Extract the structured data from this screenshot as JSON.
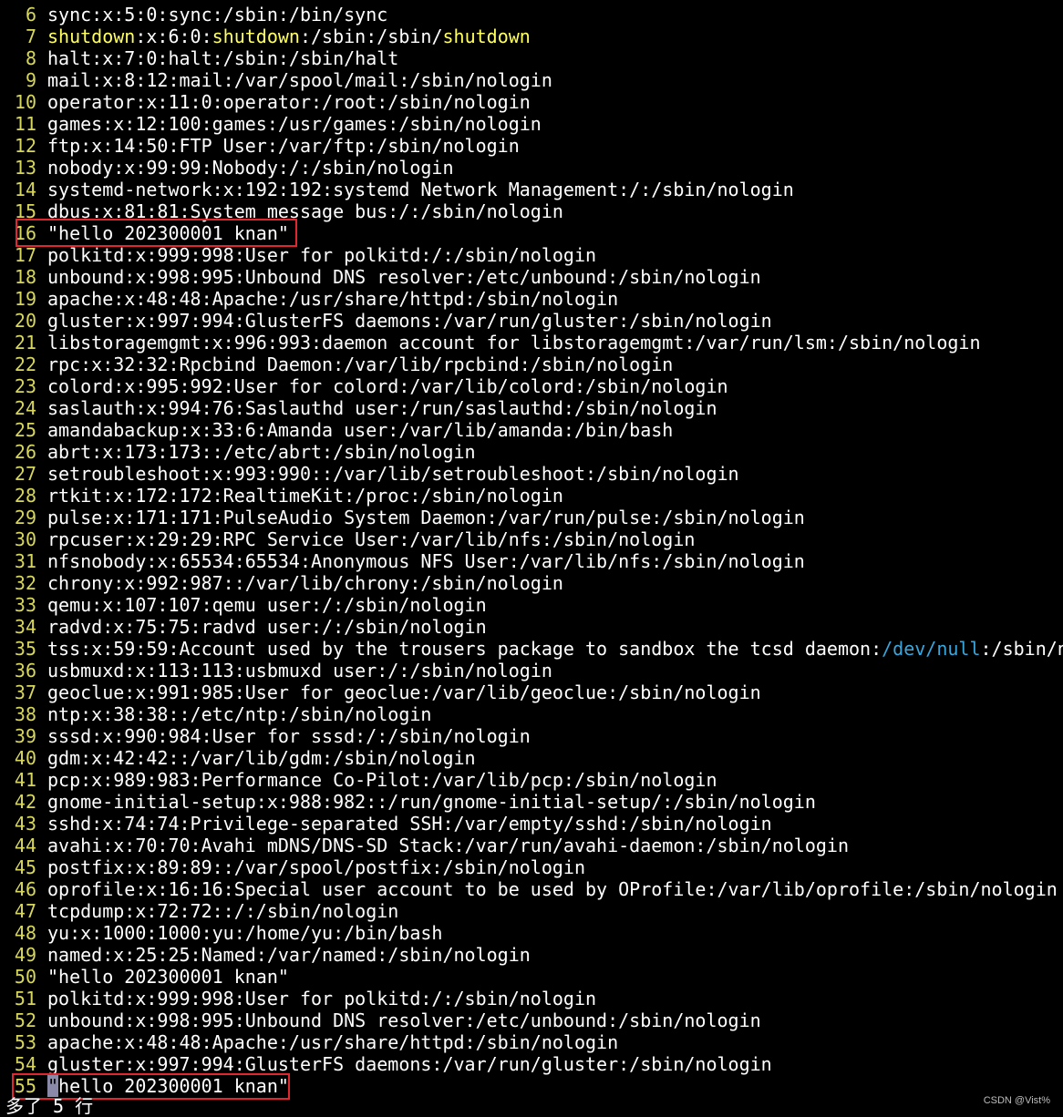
{
  "lines": [
    {
      "n": "6",
      "segments": [
        {
          "t": "sync:x:5:0:sync:/sbin:/bin/sync"
        }
      ]
    },
    {
      "n": "7",
      "segments": [
        {
          "t": "shutdown",
          "c": "kw"
        },
        {
          "t": ":x:6:0:"
        },
        {
          "t": "shutdown",
          "c": "kw"
        },
        {
          "t": ":/sbin:/sbin/"
        },
        {
          "t": "shutdown",
          "c": "kw"
        }
      ]
    },
    {
      "n": "8",
      "segments": [
        {
          "t": "halt:x:7:0:halt:/sbin:/sbin/halt"
        }
      ]
    },
    {
      "n": "9",
      "segments": [
        {
          "t": "mail:x:8:12:mail:/var/spool/mail:/sbin/nologin"
        }
      ]
    },
    {
      "n": "10",
      "segments": [
        {
          "t": "operator:x:11:0:operator:/root:/sbin/nologin"
        }
      ]
    },
    {
      "n": "11",
      "segments": [
        {
          "t": "games:x:12:100:games:/usr/games:/sbin/nologin"
        }
      ]
    },
    {
      "n": "12",
      "segments": [
        {
          "t": "ftp:x:14:50:FTP User:/var/ftp:/sbin/nologin"
        }
      ]
    },
    {
      "n": "13",
      "segments": [
        {
          "t": "nobody:x:99:99:Nobody:/:/sbin/nologin"
        }
      ]
    },
    {
      "n": "14",
      "segments": [
        {
          "t": "systemd-network:x:192:192:systemd Network Management:/:/sbin/nologin"
        }
      ]
    },
    {
      "n": "15",
      "segments": [
        {
          "t": "dbus:x:81:81:System message bus:/:/sbin/nologin"
        }
      ]
    },
    {
      "n": "16",
      "segments": [
        {
          "t": "\"hello 202300001 knan\""
        }
      ]
    },
    {
      "n": "17",
      "segments": [
        {
          "t": "polkitd:x:999:998:User for polkitd:/:/sbin/nologin"
        }
      ]
    },
    {
      "n": "18",
      "segments": [
        {
          "t": "unbound:x:998:995:Unbound DNS resolver:/etc/unbound:/sbin/nologin"
        }
      ]
    },
    {
      "n": "19",
      "segments": [
        {
          "t": "apache:x:48:48:Apache:/usr/share/httpd:/sbin/nologin"
        }
      ]
    },
    {
      "n": "20",
      "segments": [
        {
          "t": "gluster:x:997:994:GlusterFS daemons:/var/run/gluster:/sbin/nologin"
        }
      ]
    },
    {
      "n": "21",
      "segments": [
        {
          "t": "libstoragemgmt:x:996:993:daemon account for libstoragemgmt:/var/run/lsm:/sbin/nologin"
        }
      ]
    },
    {
      "n": "22",
      "segments": [
        {
          "t": "rpc:x:32:32:Rpcbind Daemon:/var/lib/rpcbind:/sbin/nologin"
        }
      ]
    },
    {
      "n": "23",
      "segments": [
        {
          "t": "colord:x:995:992:User for colord:/var/lib/colord:/sbin/nologin"
        }
      ]
    },
    {
      "n": "24",
      "segments": [
        {
          "t": "saslauth:x:994:76:Saslauthd user:/run/saslauthd:/sbin/nologin"
        }
      ]
    },
    {
      "n": "25",
      "segments": [
        {
          "t": "amandabackup:x:33:6:Amanda user:/var/lib/amanda:/bin/bash"
        }
      ]
    },
    {
      "n": "26",
      "segments": [
        {
          "t": "abrt:x:173:173::/etc/abrt:/sbin/nologin"
        }
      ]
    },
    {
      "n": "27",
      "segments": [
        {
          "t": "setroubleshoot:x:993:990::/var/lib/setroubleshoot:/sbin/nologin"
        }
      ]
    },
    {
      "n": "28",
      "segments": [
        {
          "t": "rtkit:x:172:172:RealtimeKit:/proc:/sbin/nologin"
        }
      ]
    },
    {
      "n": "29",
      "segments": [
        {
          "t": "pulse:x:171:171:PulseAudio System Daemon:/var/run/pulse:/sbin/nologin"
        }
      ]
    },
    {
      "n": "30",
      "segments": [
        {
          "t": "rpcuser:x:29:29:RPC Service User:/var/lib/nfs:/sbin/nologin"
        }
      ]
    },
    {
      "n": "31",
      "segments": [
        {
          "t": "nfsnobody:x:65534:65534:Anonymous NFS User:/var/lib/nfs:/sbin/nologin"
        }
      ]
    },
    {
      "n": "32",
      "segments": [
        {
          "t": "chrony:x:992:987::/var/lib/chrony:/sbin/nologin"
        }
      ]
    },
    {
      "n": "33",
      "segments": [
        {
          "t": "qemu:x:107:107:qemu user:/:/sbin/nologin"
        }
      ]
    },
    {
      "n": "34",
      "segments": [
        {
          "t": "radvd:x:75:75:radvd user:/:/sbin/nologin"
        }
      ]
    },
    {
      "n": "35",
      "segments": [
        {
          "t": "tss:x:59:59:Account used by the trousers package to sandbox the tcsd daemon:"
        },
        {
          "t": "/dev/null",
          "c": "path"
        },
        {
          "t": ":/sbin/n"
        }
      ]
    },
    {
      "n": "36",
      "segments": [
        {
          "t": "usbmuxd:x:113:113:usbmuxd user:/:/sbin/nologin"
        }
      ]
    },
    {
      "n": "37",
      "segments": [
        {
          "t": "geoclue:x:991:985:User for geoclue:/var/lib/geoclue:/sbin/nologin"
        }
      ]
    },
    {
      "n": "38",
      "segments": [
        {
          "t": "ntp:x:38:38::/etc/ntp:/sbin/nologin"
        }
      ]
    },
    {
      "n": "39",
      "segments": [
        {
          "t": "sssd:x:990:984:User for sssd:/:/sbin/nologin"
        }
      ]
    },
    {
      "n": "40",
      "segments": [
        {
          "t": "gdm:x:42:42::/var/lib/gdm:/sbin/nologin"
        }
      ]
    },
    {
      "n": "41",
      "segments": [
        {
          "t": "pcp:x:989:983:Performance Co-Pilot:/var/lib/pcp:/sbin/nologin"
        }
      ]
    },
    {
      "n": "42",
      "segments": [
        {
          "t": "gnome-initial-setup:x:988:982::/run/gnome-initial-setup/:/sbin/nologin"
        }
      ]
    },
    {
      "n": "43",
      "segments": [
        {
          "t": "sshd:x:74:74:Privilege-separated SSH:/var/empty/sshd:/sbin/nologin"
        }
      ]
    },
    {
      "n": "44",
      "segments": [
        {
          "t": "avahi:x:70:70:Avahi mDNS/DNS-SD Stack:/var/run/avahi-daemon:/sbin/nologin"
        }
      ]
    },
    {
      "n": "45",
      "segments": [
        {
          "t": "postfix:x:89:89::/var/spool/postfix:/sbin/nologin"
        }
      ]
    },
    {
      "n": "46",
      "segments": [
        {
          "t": "oprofile:x:16:16:Special user account to be used by OProfile:/var/lib/oprofile:/sbin/nologin"
        }
      ]
    },
    {
      "n": "47",
      "segments": [
        {
          "t": "tcpdump:x:72:72::/:/sbin/nologin"
        }
      ]
    },
    {
      "n": "48",
      "segments": [
        {
          "t": "yu:x:1000:1000:yu:/home/yu:/bin/bash"
        }
      ]
    },
    {
      "n": "49",
      "segments": [
        {
          "t": "named:x:25:25:Named:/var/named:/sbin/nologin"
        }
      ]
    },
    {
      "n": "50",
      "segments": [
        {
          "t": "\"hello 202300001 knan\""
        }
      ]
    },
    {
      "n": "51",
      "segments": [
        {
          "t": "polkitd:x:999:998:User for polkitd:/:/sbin/nologin"
        }
      ]
    },
    {
      "n": "52",
      "segments": [
        {
          "t": "unbound:x:998:995:Unbound DNS resolver:/etc/unbound:/sbin/nologin"
        }
      ]
    },
    {
      "n": "53",
      "segments": [
        {
          "t": "apache:x:48:48:Apache:/usr/share/httpd:/sbin/nologin"
        }
      ]
    },
    {
      "n": "54",
      "segments": [
        {
          "t": "gluster:x:997:994:GlusterFS daemons:/var/run/gluster:/sbin/nologin"
        }
      ]
    },
    {
      "n": "55",
      "segments": [
        {
          "t": "\"",
          "c": "cursor"
        },
        {
          "t": "hello 202300001 knan\""
        }
      ]
    }
  ],
  "status_message": "多了 5 行",
  "watermark": "CSDN @Vist%",
  "colors": {
    "background": "#000000",
    "line_number": "#d7d75f",
    "keyword": "#ffff5f",
    "path": "#3aa6dc",
    "highlight_box": "#e0262f"
  }
}
